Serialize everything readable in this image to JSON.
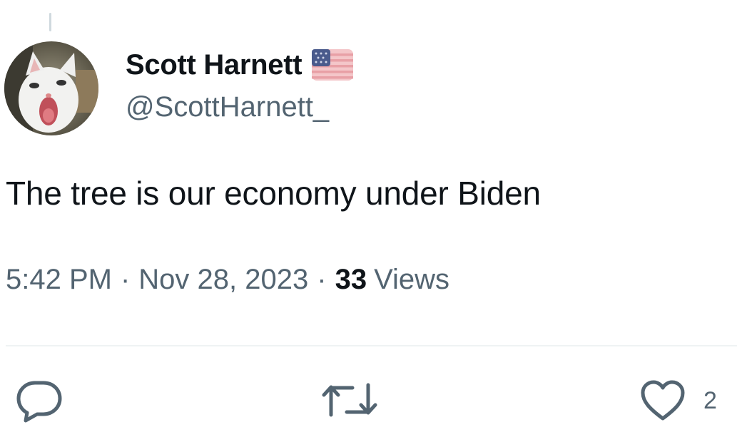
{
  "tweet": {
    "author": {
      "display_name": "Scott Harnett",
      "handle": "@ScottHarnett_",
      "flag_icon": "us-flag-icon",
      "avatar_icon": "cat-avatar"
    },
    "text": "The tree is our economy under Biden",
    "time": "5:42 PM",
    "separator": "·",
    "date": "Nov 28, 2023",
    "views_count": "33",
    "views_label": "Views"
  },
  "actions": {
    "reply_icon": "reply-icon",
    "retweet_icon": "retweet-icon",
    "like_icon": "heart-icon",
    "like_count": "2"
  },
  "colors": {
    "primary_text": "#0f1419",
    "secondary_text": "#536471",
    "divider": "#eff3f4"
  }
}
